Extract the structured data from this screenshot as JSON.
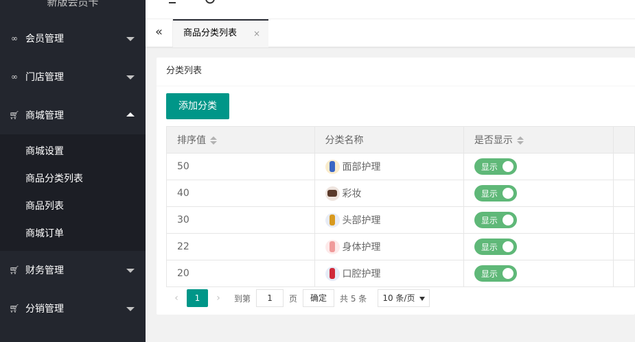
{
  "sidebar": {
    "brand": "新版会员卡",
    "items": [
      {
        "label": "会员管理",
        "icon": "link-icon",
        "expanded": false
      },
      {
        "label": "门店管理",
        "icon": "link-icon",
        "expanded": false
      },
      {
        "label": "商城管理",
        "icon": "cart-icon",
        "expanded": true
      },
      {
        "label": "财务管理",
        "icon": "cart-icon",
        "expanded": false
      },
      {
        "label": "分销管理",
        "icon": "cart-icon",
        "expanded": false
      }
    ],
    "sub_items": [
      "商城设置",
      "商品分类列表",
      "商品列表",
      "商城订单"
    ]
  },
  "tabs": [
    {
      "label": "商品分类列表",
      "close": "×"
    }
  ],
  "card": {
    "title": "分类列表",
    "add_button": "添加分类"
  },
  "table": {
    "headers": [
      "排序值",
      "分类名称",
      "是否显示"
    ],
    "rows": [
      {
        "sort": "50",
        "name": "面部护理",
        "show": "显示",
        "thumb_color": "#3b66c4",
        "thumb_bg": "#fbeccc"
      },
      {
        "sort": "40",
        "name": "彩妆",
        "show": "显示",
        "thumb_color": "#5a3a2a",
        "thumb_bg": "#eee4de"
      },
      {
        "sort": "30",
        "name": "头部护理",
        "show": "显示",
        "thumb_color": "#d89a20",
        "thumb_bg": "#e8ecf6"
      },
      {
        "sort": "22",
        "name": "身体护理",
        "show": "显示",
        "thumb_color": "#f09a9a",
        "thumb_bg": "#fdeaea"
      },
      {
        "sort": "20",
        "name": "口腔护理",
        "show": "显示",
        "thumb_color": "#d02a3a",
        "thumb_bg": "#e6ecf8"
      }
    ]
  },
  "pager": {
    "current_page": "1",
    "goto_label": "到第",
    "goto_value": "1",
    "page_unit": "页",
    "confirm": "确定",
    "total": "共 5 条",
    "page_size": "10 条/页"
  },
  "colors": {
    "accent": "#009688",
    "toggle_on": "#5fb878",
    "sidebar_bg": "#23262e"
  }
}
